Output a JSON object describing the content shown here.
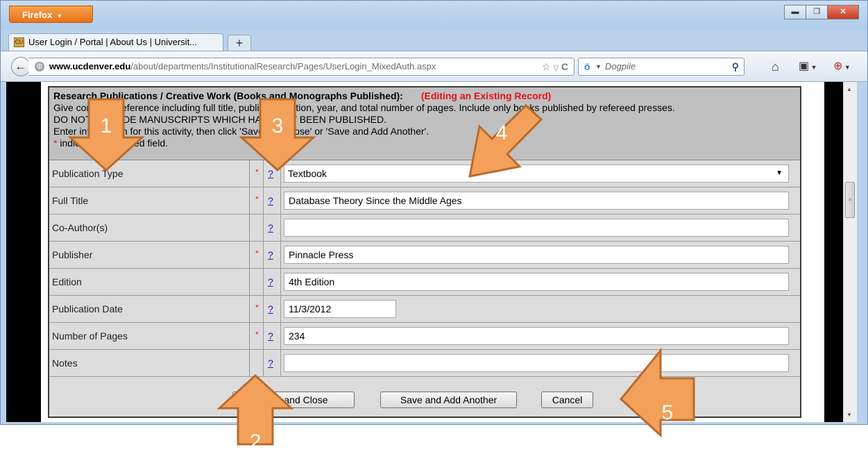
{
  "browser": {
    "menu_button": "Firefox",
    "tab_title": "User Login / Portal | About Us | Universit...",
    "new_tab": "+",
    "url_host": "www.ucdenver.edu",
    "url_path": "/about/departments/InstitutionalResearch/Pages/UserLogin_MixedAuth.aspx",
    "search_engine": "Dogpile",
    "window_controls": [
      "minimize",
      "restore",
      "close"
    ],
    "toolbar_icons": [
      "home-icon",
      "bookmarks-icon",
      "addon-icon"
    ]
  },
  "form": {
    "header": {
      "section_title": "Research Publications / Creative Work (Books and Monographs Published):",
      "editing_note": "(Editing an Existing Record)",
      "instruction_1": "Give complete reference including full title, publisher, edition, year, and total number of pages. Include only books published by refereed presses.",
      "instruction_2": "DO NOT INCLUDE MANUSCRIPTS WHICH HAVE NOT BEEN PUBLISHED.",
      "instruction_3": "Enter information for this activity, then click 'Save and Close' or 'Save and Add Another'.",
      "required_star": "*",
      "required_note": " indicates a required field."
    },
    "fields": [
      {
        "label": "Publication Type",
        "required": true,
        "value": "Textbook",
        "type": "select"
      },
      {
        "label": "Full Title",
        "required": true,
        "value": "Database Theory Since the Middle Ages",
        "type": "text"
      },
      {
        "label": "Co-Author(s)",
        "required": false,
        "value": "",
        "type": "text"
      },
      {
        "label": "Publisher",
        "required": true,
        "value": "Pinnacle Press",
        "type": "text"
      },
      {
        "label": "Edition",
        "required": false,
        "value": "4th Edition",
        "type": "text"
      },
      {
        "label": "Publication Date",
        "required": true,
        "value": "11/3/2012",
        "type": "date"
      },
      {
        "label": "Number of Pages",
        "required": true,
        "value": "234",
        "type": "text"
      },
      {
        "label": "Notes",
        "required": false,
        "value": "",
        "type": "text"
      }
    ],
    "help_glyph": "?",
    "required_glyph": "*",
    "buttons": {
      "save_close": "Save and Close",
      "save_another": "Save and Add Another",
      "cancel": "Cancel"
    }
  },
  "callouts": [
    "1",
    "2",
    "3",
    "4",
    "5"
  ],
  "colors": {
    "arrow_fill": "#f3a05a",
    "arrow_stroke": "#b86b2c",
    "required": "#e8101a",
    "help_link": "#1a1acb",
    "firefox_orange": "#e7731a"
  }
}
